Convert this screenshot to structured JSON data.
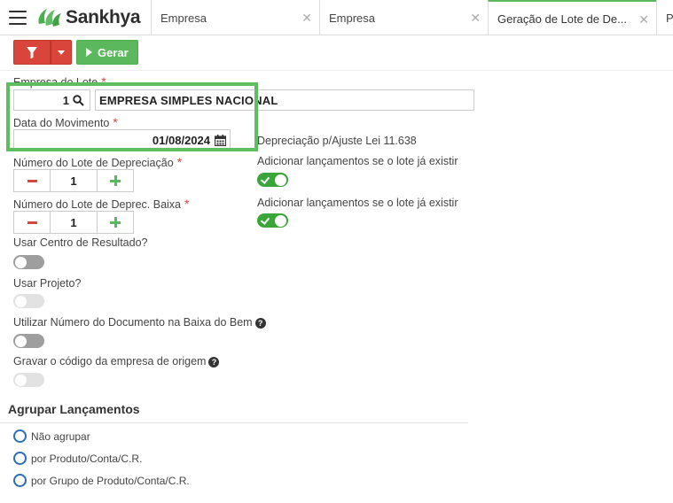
{
  "header": {
    "brand": "Sankhya",
    "tabs": [
      {
        "label": "Empresa",
        "closable": true
      },
      {
        "label": "Empresa",
        "closable": true
      },
      {
        "label": "Geração de Lote de De...",
        "closable": true,
        "active": true
      },
      {
        "label": "P"
      }
    ]
  },
  "toolbar": {
    "gerar_label": "Gerar"
  },
  "form": {
    "empresa_label": "Empresa do Lote",
    "empresa_code": "1",
    "empresa_name": "EMPRESA SIMPLES NACIONAL",
    "data_label": "Data do Movimento",
    "data_value": "01/08/2024",
    "depreciacao_label": "Depreciação p/Ajuste Lei 11.638",
    "lote_dep_label": "Número do Lote de Depreciação",
    "lote_dep_value": "1",
    "lote_dep_add_label": "Adicionar lançamentos se o lote já existir",
    "lote_baixa_label": "Número do Lote de Deprec. Baixa",
    "lote_baixa_value": "1",
    "lote_baixa_add_label": "Adicionar lançamentos se o lote já existir",
    "centro_label": "Usar Centro de Resultado?",
    "projeto_label": "Usar Projeto?",
    "num_doc_label": "Utilizar Número do Documento na Baixa do Bem",
    "cod_empresa_label": "Gravar o código da empresa de origem",
    "help_glyph": "?"
  },
  "toggles": {
    "lote_dep_add": "on",
    "lote_baixa_add": "on",
    "centro": "off",
    "projeto": "disabled",
    "num_doc": "off",
    "cod_empresa": "disabled"
  },
  "grouping": {
    "title": "Agrupar Lançamentos",
    "options": [
      "Não agrupar",
      "por Produto/Conta/C.R.",
      "por Grupo de Produto/Conta/C.R."
    ]
  },
  "colors": {
    "accent_green": "#5cb85c",
    "filter_red": "#d9453a",
    "highlight_green": "#5ebd5e",
    "radio_blue": "#2a6ebb"
  },
  "icons": {
    "menu": "hamburger-icon",
    "filter": "funnel-icon",
    "search": "magnifier-icon",
    "calendar": "calendar-icon"
  }
}
